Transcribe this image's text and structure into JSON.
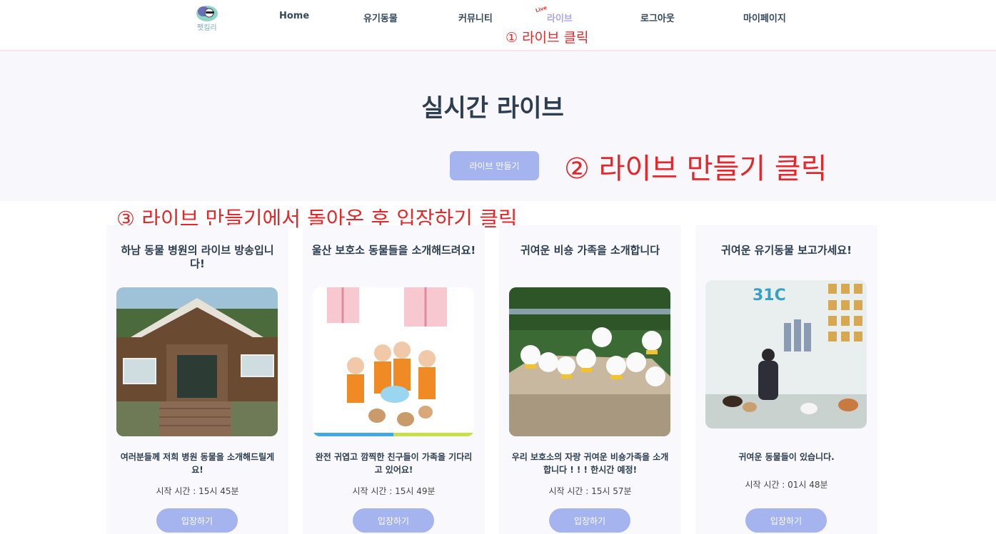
{
  "nav": {
    "home": "Home",
    "animals": "유기동물",
    "community": "커뮤니티",
    "live": "라이브",
    "live_badge": "Live",
    "logout": "로그아웃",
    "mypage": "마이페이지",
    "logo_text": "펫킬리"
  },
  "annotations": {
    "step1": "① 라이브 클릭",
    "step2": "② 라이브 만들기 클릭",
    "step3": "③ 라이브 만들기에서 돌아온 후 입장하기 클릭"
  },
  "hero": {
    "title": "실시간 라이브",
    "create_button": "라이브 만들기"
  },
  "cards": [
    {
      "title": "하남 동물 병원의 라이브 방송입니다!",
      "image": "animal-hospital-building",
      "description": "여러분들께 저희 병원 동물을 소개해드릴게요!",
      "start_time": "시작 시간 : 15시 45분",
      "enter_button": "입장하기"
    },
    {
      "title": "울산 보호소 동물들을 소개해드려요!",
      "image": "volunteers-illustration",
      "description": "완전 귀엽고 깜찍한 친구들이 가족을 기다리고 있어요!",
      "start_time": "시작 시간 : 15시 49분",
      "enter_button": "입장하기"
    },
    {
      "title": "귀여운 비숑 가족을 소개합니다",
      "image": "bichon-dogs-on-rock",
      "description": "우리 보호소의 자랑 귀여운 비숑가족을 소개합니다 ! ! ! 한시간 예정!",
      "start_time": "시작 시간 : 15시 57분",
      "enter_button": "입장하기"
    },
    {
      "title": "귀여운 유기동물 보고가세요!",
      "image": "shelter-center-dogs",
      "description": "귀여운 동물들이 있습니다.",
      "start_time": "시작 시간 : 01시 48분",
      "enter_button": "입장하기"
    }
  ],
  "colors": {
    "accent": "#a5b4ee",
    "annotation": "#e5262b",
    "hero_bg": "#f8f8fc",
    "card_bg": "#f8f8fd"
  }
}
